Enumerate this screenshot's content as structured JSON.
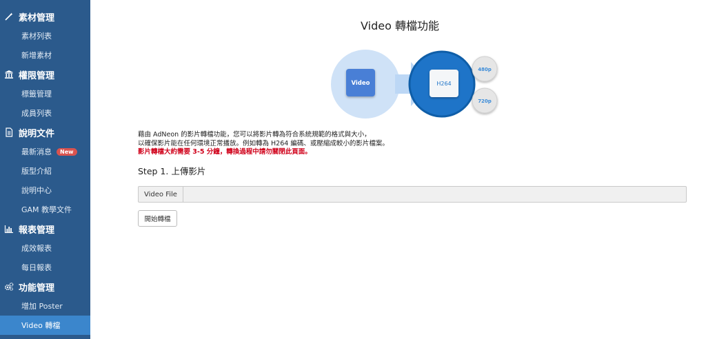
{
  "sidebar": {
    "sections": [
      {
        "label": "素材管理",
        "icon": "magic-wand-icon"
      },
      {
        "label": "權限管理",
        "icon": "institution-icon"
      },
      {
        "label": "說明文件",
        "icon": "document-icon"
      },
      {
        "label": "報表管理",
        "icon": "bar-chart-icon"
      },
      {
        "label": "功能管理",
        "icon": "gears-icon"
      }
    ],
    "items": {
      "material_list": "素材列表",
      "add_material": "新增素材",
      "tag_management": "標籤管理",
      "member_list": "成員列表",
      "latest_news": "最新消息",
      "new_badge": "New",
      "layout_intro": "版型介紹",
      "help_center": "說明中心",
      "gam_docs": "GAM 教學文件",
      "performance_report": "成效報表",
      "daily_report": "每日報表",
      "add_poster": "增加 Poster",
      "video_convert": "Video 轉檔"
    }
  },
  "main": {
    "title": "Video 轉檔功能",
    "diagram": {
      "source_label": "Video",
      "target_label": "H264",
      "option_1": "480p",
      "option_2": "720p"
    },
    "desc_line1": "藉由 AdNeon 的影片轉檔功能，您可以將影片轉為符合系統規範的格式與大小，",
    "desc_line2": "以確保影片能在任何環境正常播放。例如轉為 H264 編碼、或壓縮成較小的影片檔案。",
    "desc_warning": "影片轉檔大約需要 3-5 分鐘，轉換過程中請勿關閉此頁面。",
    "step_title": "Step 1. 上傳影片",
    "file_button_label": "Video File",
    "file_value": "",
    "start_button": "開始轉檔"
  },
  "colors": {
    "sidebar_bg": "#2b5a8c",
    "active_item": "#3b86cc",
    "badge": "#d9534f",
    "warning_text": "#d0021b"
  }
}
